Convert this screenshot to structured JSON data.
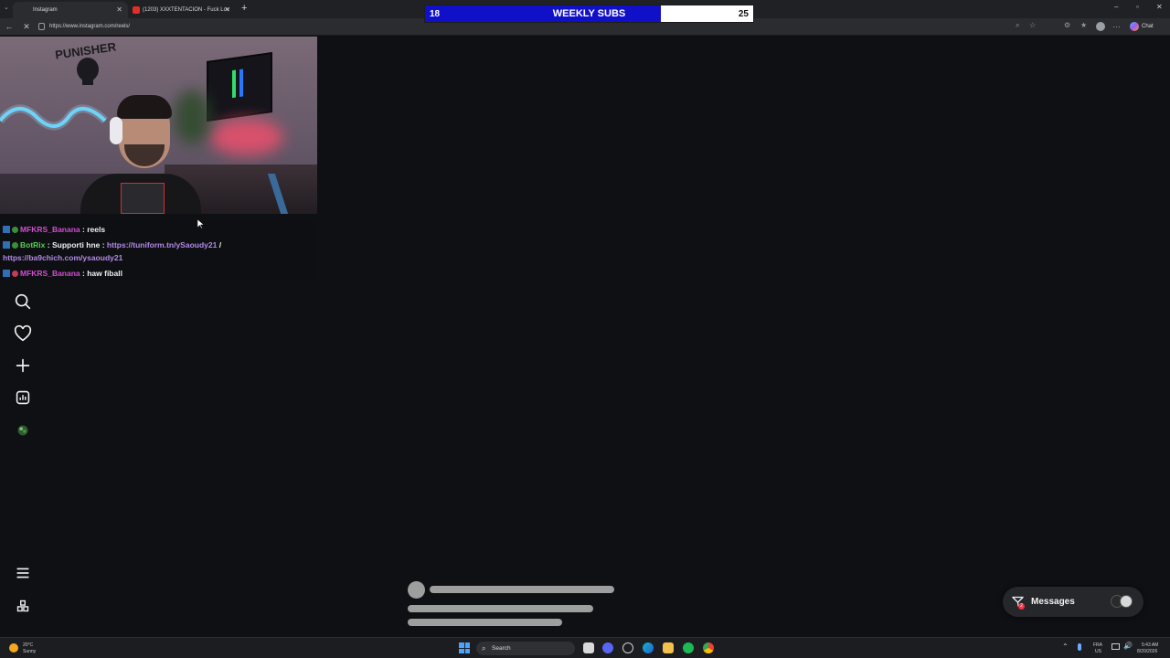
{
  "browser": {
    "tabs": [
      {
        "title": "Instagram",
        "active": true
      },
      {
        "title": "(1203) XXXTENTACION - Fuck Lov",
        "active": false
      }
    ],
    "url": "https://www.instagram.com/reels/",
    "profile_label": "Chat"
  },
  "subs_goal": {
    "label": "WEEKLY SUBS",
    "current": "18",
    "goal": "25",
    "progress_fraction": 0.72,
    "fill_color": "#1010c8"
  },
  "chat": [
    {
      "user": "MFKRS_Banana",
      "sep": " : ",
      "text": "reels"
    },
    {
      "user": "BotRix",
      "sep": " : ",
      "text": "Supporti hne : ",
      "link1": "https://tuniform.tn/ySaoudy21",
      "slash": " /",
      "link2": "https://ba9chich.com/ysaoudy21"
    },
    {
      "user": "MFKRS_Banana",
      "sep": " : ",
      "text": "haw fiball"
    }
  ],
  "instagram": {
    "side_icons": [
      "search-icon",
      "heart-icon",
      "plus-icon",
      "dashboard-icon",
      "profile-avatar",
      "menu-icon",
      "apps-icon"
    ],
    "messages_label": "Messages",
    "messages_badge": "2"
  },
  "taskbar": {
    "weather_temp": "20°C",
    "weather_desc": "Sunny",
    "search_placeholder": "Search",
    "lang_top": "FRA",
    "lang_bottom": "US",
    "time": "5:43 AM",
    "date": "8/20/2026"
  }
}
